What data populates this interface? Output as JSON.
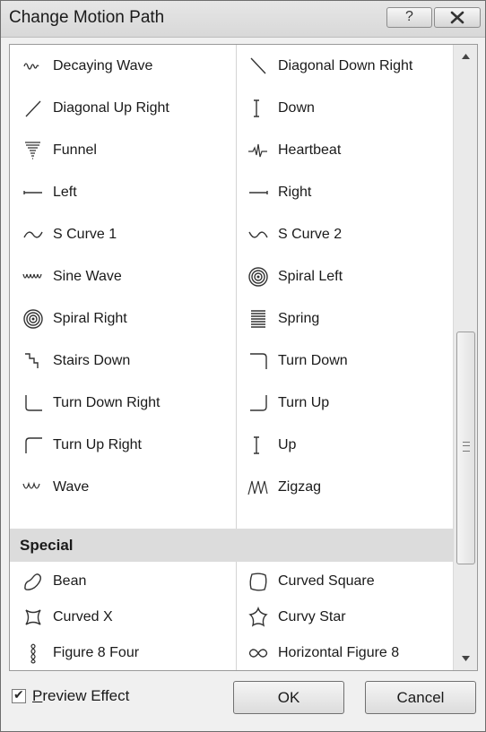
{
  "window": {
    "title": "Change Motion Path",
    "help_label": "?"
  },
  "list": {
    "rows": [
      {
        "left": {
          "label": "Decaying Wave",
          "icon": "decaying-wave-icon"
        },
        "right": {
          "label": "Diagonal Down Right",
          "icon": "diagonal-down-right-icon"
        }
      },
      {
        "left": {
          "label": "Diagonal Up Right",
          "icon": "diagonal-up-right-icon"
        },
        "right": {
          "label": "Down",
          "icon": "down-icon"
        }
      },
      {
        "left": {
          "label": "Funnel",
          "icon": "funnel-icon"
        },
        "right": {
          "label": "Heartbeat",
          "icon": "heartbeat-icon"
        }
      },
      {
        "left": {
          "label": "Left",
          "icon": "left-icon"
        },
        "right": {
          "label": "Right",
          "icon": "right-icon"
        }
      },
      {
        "left": {
          "label": "S Curve 1",
          "icon": "s-curve-1-icon"
        },
        "right": {
          "label": "S Curve 2",
          "icon": "s-curve-2-icon"
        }
      },
      {
        "left": {
          "label": "Sine Wave",
          "icon": "sine-wave-icon"
        },
        "right": {
          "label": "Spiral Left",
          "icon": "spiral-left-icon"
        }
      },
      {
        "left": {
          "label": "Spiral Right",
          "icon": "spiral-right-icon"
        },
        "right": {
          "label": "Spring",
          "icon": "spring-icon"
        }
      },
      {
        "left": {
          "label": "Stairs Down",
          "icon": "stairs-down-icon"
        },
        "right": {
          "label": "Turn Down",
          "icon": "turn-down-icon"
        }
      },
      {
        "left": {
          "label": "Turn Down Right",
          "icon": "turn-down-right-icon"
        },
        "right": {
          "label": "Turn Up",
          "icon": "turn-up-icon"
        }
      },
      {
        "left": {
          "label": "Turn Up Right",
          "icon": "turn-up-right-icon"
        },
        "right": {
          "label": "Up",
          "icon": "up-icon"
        }
      },
      {
        "left": {
          "label": "Wave",
          "icon": "wave-icon"
        },
        "right": {
          "label": "Zigzag",
          "icon": "zigzag-icon"
        }
      }
    ],
    "section_title": "Special",
    "special_rows": [
      {
        "left": {
          "label": "Bean",
          "icon": "bean-icon"
        },
        "right": {
          "label": "Curved Square",
          "icon": "curved-square-icon"
        }
      },
      {
        "left": {
          "label": "Curved X",
          "icon": "curved-x-icon"
        },
        "right": {
          "label": "Curvy Star",
          "icon": "curvy-star-icon"
        }
      },
      {
        "left": {
          "label": "Figure 8 Four",
          "icon": "figure-8-four-icon"
        },
        "right": {
          "label": "Horizontal Figure 8",
          "icon": "horizontal-figure-8-icon"
        }
      }
    ]
  },
  "footer": {
    "preview_checked": true,
    "preview_label_underlined": "P",
    "preview_label_rest": "review Effect",
    "ok_label": "OK",
    "cancel_label": "Cancel"
  }
}
